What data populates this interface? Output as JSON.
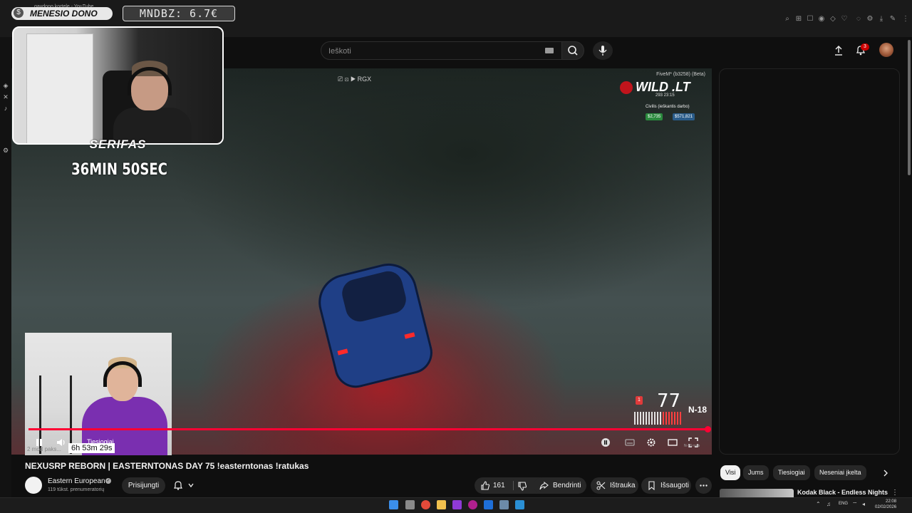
{
  "browser": {
    "tab_title": "gavdono kortele - YouTube"
  },
  "overlay": {
    "donate_label": "MENESIO DONO",
    "donate_amount": "MNDBZ: 6.7€",
    "streamer_name": "SERIFAS",
    "timer": "36MIN 50SEC"
  },
  "header": {
    "search_placeholder": "Ieškoti",
    "notification_count": "3"
  },
  "video": {
    "hud_server": "FiveM* (b3258) (Beta)",
    "hud_logo": "WILD  .LT",
    "hud_stats": "293   23:15",
    "hud_job": "Civilis (ieškantis darbo)",
    "hud_cash": "$2,735",
    "hud_bank": "$571,821",
    "hud_top": "⎚ ⊡ ▶ RGX",
    "speed": "77",
    "speed_badge": "1",
    "gear": "N-18",
    "live_label": "Tiesiogiai",
    "timer_overlay": "6h 53m 29s",
    "viewers_text": "2 mod paks...",
    "progress": 1.0,
    "rating_text": "N-18 rodo"
  },
  "meta": {
    "title": "NEXUSRP REBORN | EASTERNTONAS DAY 75 !easterntonas !ratukas",
    "channel_name": "Eastern European",
    "subscribers": "119 tūkst. prenumeratorių",
    "subscribe_label": "Prisijungti",
    "like_count": "161",
    "share_label": "Bendrinti",
    "clip_label": "Ištrauka",
    "save_label": "Išsaugoti"
  },
  "sidebar": {
    "chips": [
      "Visi",
      "Jums",
      "Tiesiogiai",
      "Neseniai įkelta"
    ],
    "recommendations": [
      {
        "title": "Kodak Black - Endless Nights"
      }
    ]
  },
  "taskbar": {
    "lang": "ENG",
    "time": "22:08",
    "date": "02/02/2026"
  },
  "colors": {
    "accent": "#ff0033",
    "background": "#0f0f0f",
    "pill": "#272727"
  }
}
